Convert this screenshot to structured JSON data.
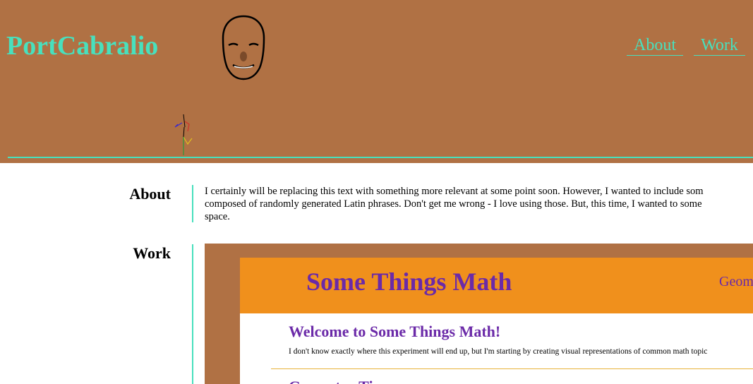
{
  "header": {
    "site_title": "PortCabralio",
    "nav": {
      "about": "About",
      "work": "Work"
    },
    "accent_color": "#48e0bd",
    "background_color": "#b07144",
    "face_icon": "face-drawing-icon",
    "figure_icon": "stick-figure-icon"
  },
  "about": {
    "title": "About",
    "lines": [
      "I certainly will be replacing this text with something more relevant at some point soon. However, I wanted to include som",
      "composed of randomly generated Latin phrases. Don't get me wrong - I love using those. But, this time, I wanted to some",
      "space."
    ]
  },
  "work": {
    "title": "Work",
    "preview": {
      "site_title": "Some Things Math",
      "nav_item": "Geom",
      "welcome_heading": "Welcome to Some Things Math!",
      "description": "I don't know exactly where this experiment will end up, but I'm starting by creating visual representations of common math topic",
      "next_heading": "Geometry Ti",
      "header_color": "#f0901c",
      "title_color": "#6b2aa8"
    }
  }
}
